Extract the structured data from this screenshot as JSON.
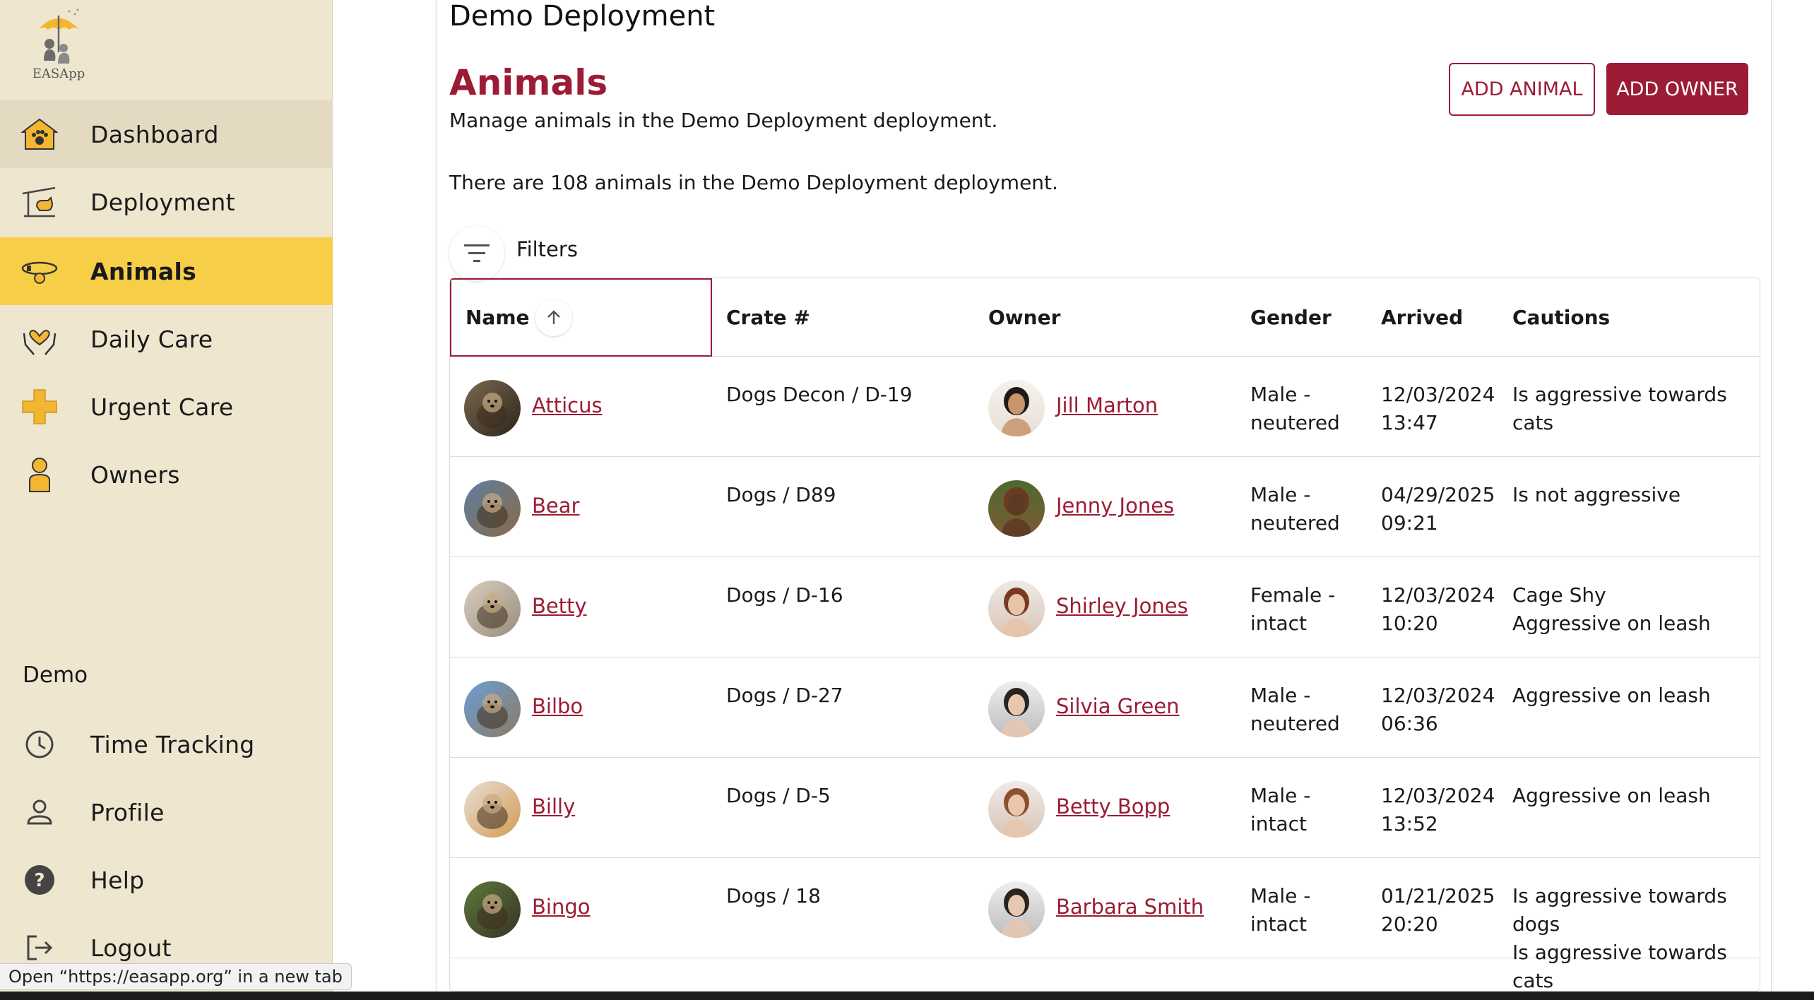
{
  "app": {
    "logo_text": "EASApp",
    "status_url_text": "Open “https://easapp.org” in a new tab"
  },
  "sidebar": {
    "items": [
      {
        "label": "Dashboard",
        "icon": "dashboard-paw-house-icon"
      },
      {
        "label": "Deployment",
        "icon": "deployment-shelter-icon"
      },
      {
        "label": "Animals",
        "icon": "collar-icon"
      },
      {
        "label": "Daily Care",
        "icon": "heart-hands-icon"
      },
      {
        "label": "Urgent Care",
        "icon": "medical-cross-icon"
      },
      {
        "label": "Owners",
        "icon": "person-icon"
      }
    ],
    "section_label": "Demo",
    "secondary_items": [
      {
        "label": "Time Tracking",
        "icon": "clock-icon"
      },
      {
        "label": "Profile",
        "icon": "profile-icon"
      },
      {
        "label": "Help",
        "icon": "help-icon"
      },
      {
        "label": "Logout",
        "icon": "logout-icon"
      }
    ],
    "active": "Animals"
  },
  "header": {
    "breadcrumb": "Demo Deployment",
    "title": "Animals",
    "subtitle": "Manage animals in the Demo Deployment deployment.",
    "count_text": "There are 108 animals in the Demo Deployment deployment.",
    "add_animal_label": "ADD ANIMAL",
    "add_owner_label": "ADD OWNER"
  },
  "filters": {
    "label": "Filters",
    "active_indicator_color": "#f6ce48"
  },
  "table": {
    "columns": [
      "Name",
      "Crate #",
      "Owner",
      "Gender",
      "Arrived",
      "Cautions"
    ],
    "sorted_column": "Name",
    "sort_direction": "ascending",
    "rows": [
      {
        "name": "Atticus",
        "crate": "Dogs Decon / D-19",
        "owner": "Jill Marton",
        "gender": [
          "Male -",
          "neutered"
        ],
        "arrived": [
          "12/03/2024",
          "13:47"
        ],
        "cautions": [
          "Is aggressive towards",
          "cats"
        ]
      },
      {
        "name": "Bear",
        "crate": "Dogs / D89",
        "owner": "Jenny Jones",
        "gender": [
          "Male -",
          "neutered"
        ],
        "arrived": [
          "04/29/2025",
          "09:21"
        ],
        "cautions": [
          "Is not aggressive"
        ]
      },
      {
        "name": "Betty",
        "crate": "Dogs / D-16",
        "owner": "Shirley Jones",
        "gender": [
          "Female -",
          "intact"
        ],
        "arrived": [
          "12/03/2024",
          "10:20"
        ],
        "cautions": [
          "Cage Shy",
          "Aggressive on leash"
        ]
      },
      {
        "name": "Bilbo",
        "crate": "Dogs / D-27",
        "owner": "Silvia Green",
        "gender": [
          "Male -",
          "neutered"
        ],
        "arrived": [
          "12/03/2024",
          "06:36"
        ],
        "cautions": [
          "Aggressive on leash"
        ]
      },
      {
        "name": "Billy",
        "crate": "Dogs / D-5",
        "owner": "Betty Bopp",
        "gender": [
          "Male -",
          "intact"
        ],
        "arrived": [
          "12/03/2024",
          "13:52"
        ],
        "cautions": [
          "Aggressive on leash"
        ]
      },
      {
        "name": "Bingo",
        "crate": "Dogs / 18",
        "owner": "Barbara Smith",
        "gender": [
          "Male -",
          "intact"
        ],
        "arrived": [
          "01/21/2025",
          "20:20"
        ],
        "cautions": [
          "Is aggressive towards",
          "dogs",
          "Is aggressive towards",
          "cats"
        ]
      }
    ]
  },
  "colors": {
    "brand": "#9b1c34",
    "sidebar_bg": "#efe6d0",
    "active_nav": "#f6ce48",
    "hover_nav": "#e4dac2"
  }
}
